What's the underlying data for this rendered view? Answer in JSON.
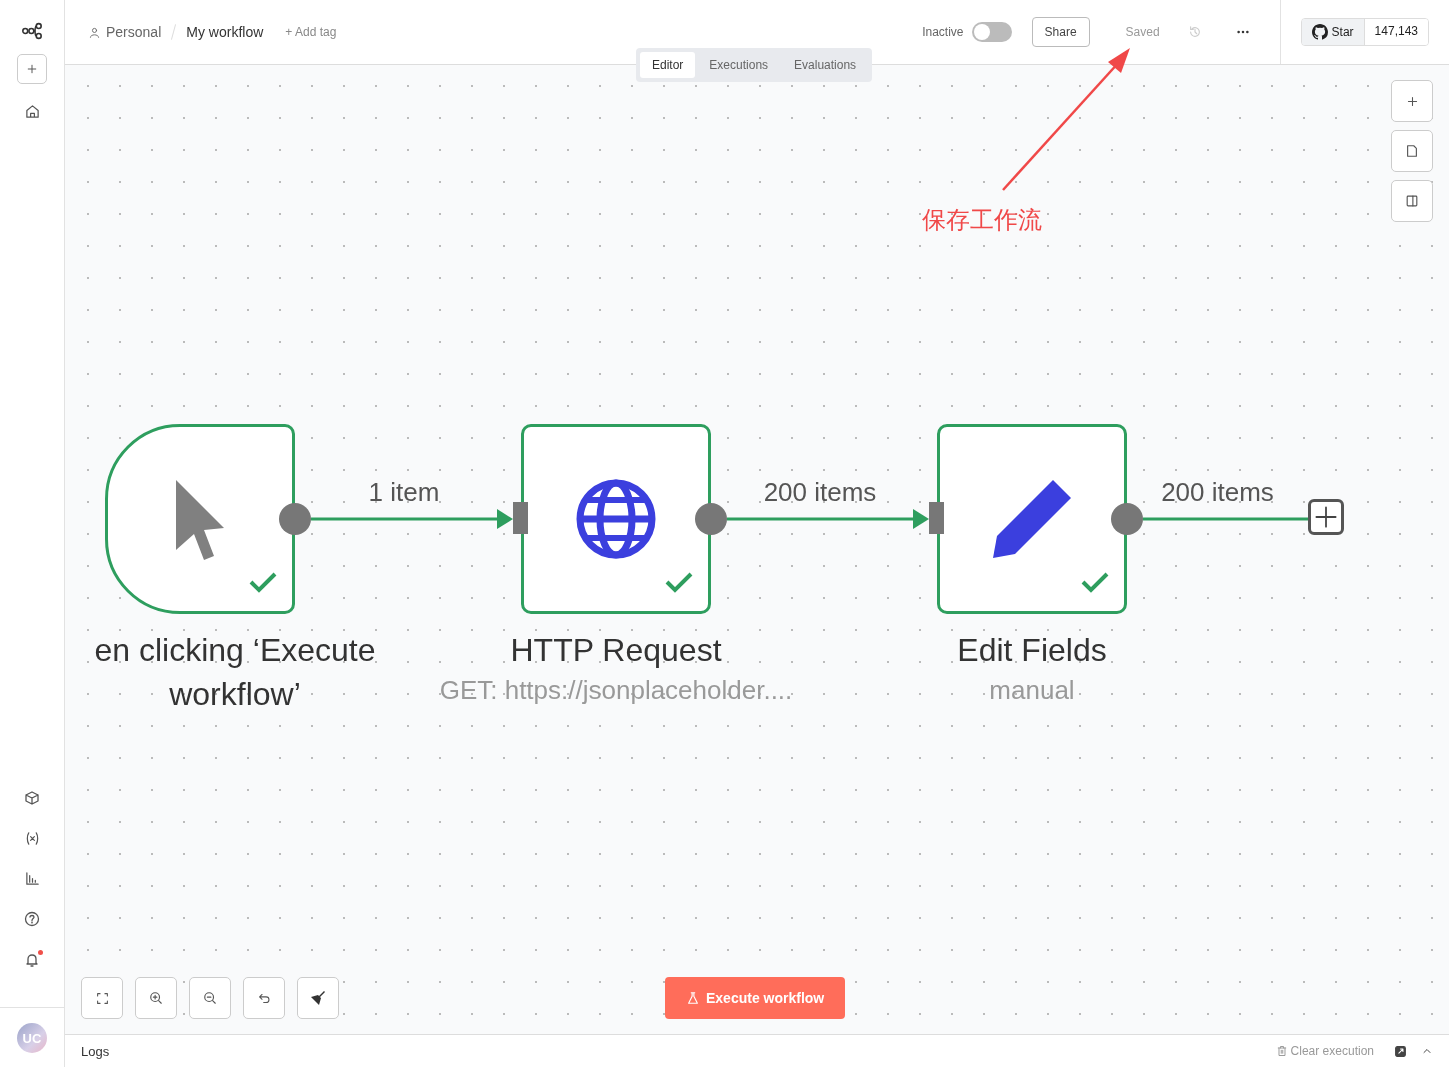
{
  "sidebar": {
    "notifications": {
      "unread": true
    },
    "avatar": "UC"
  },
  "header": {
    "breadcrumb": [
      "Personal",
      "My workflow"
    ],
    "add_tag": "+ Add tag",
    "toggle": {
      "label": "Inactive",
      "on": false
    },
    "share": "Share",
    "status": "Saved",
    "github": {
      "label": "Star",
      "count": "147,143"
    }
  },
  "tabs": [
    {
      "label": "Editor",
      "selected": true
    },
    {
      "label": "Executions",
      "selected": false
    },
    {
      "label": "Evaluations",
      "selected": false
    }
  ],
  "nodes": [
    {
      "kind": "trigger",
      "title": "en clicking ‘Execute workflow’",
      "success": true
    },
    {
      "kind": "http",
      "title": "HTTP Request",
      "subtitle": "GET: https://jsonplaceholder....",
      "success": true
    },
    {
      "kind": "edit",
      "title": "Edit Fields",
      "subtitle": "manual",
      "success": true
    }
  ],
  "connections": [
    {
      "label": "1 item"
    },
    {
      "label": "200 items"
    },
    {
      "label": "200 items"
    }
  ],
  "execute_button": "Execute workflow",
  "annotation": {
    "text": "保存工作流"
  },
  "logs": {
    "title": "Logs",
    "clear": "Clear execution"
  }
}
